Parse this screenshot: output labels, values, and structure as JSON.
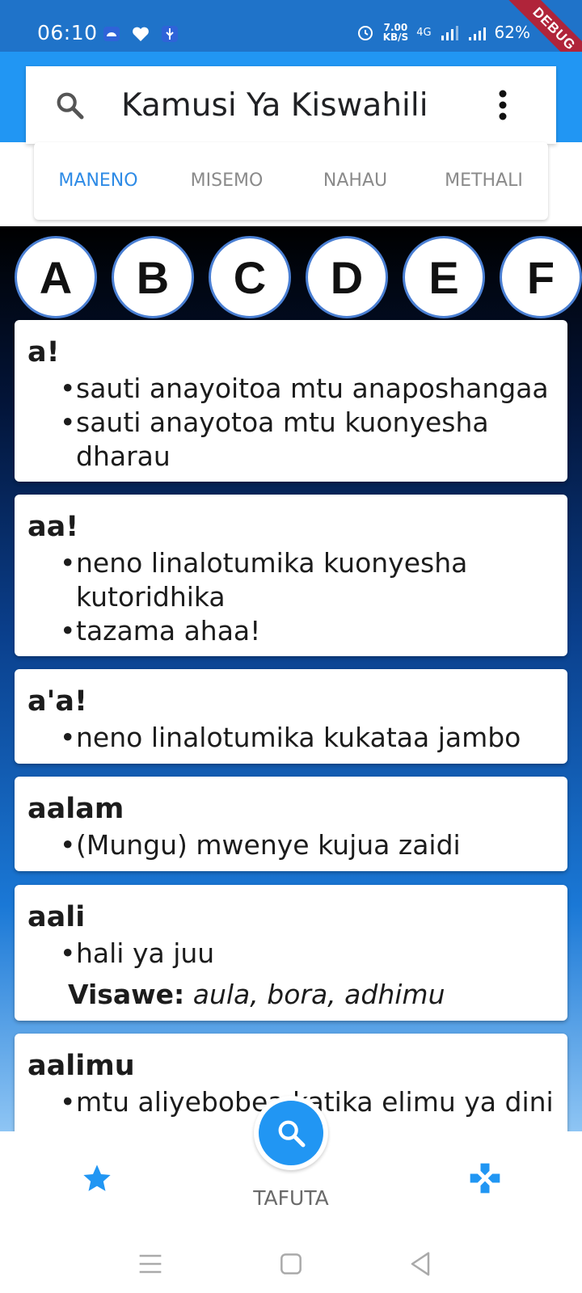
{
  "status": {
    "time": "06:10",
    "net_speed_value": "7.00",
    "net_speed_unit": "KB/S",
    "network": "4G",
    "battery": "62%",
    "debug_label": "DEBUG"
  },
  "header": {
    "title": "Kamusi Ya Kiswahili",
    "tabs": [
      {
        "label": "MANENO",
        "active": true
      },
      {
        "label": "MISEMO",
        "active": false
      },
      {
        "label": "NAHAU",
        "active": false
      },
      {
        "label": "METHALI",
        "active": false
      }
    ]
  },
  "letters": [
    "A",
    "B",
    "C",
    "D",
    "E",
    "F"
  ],
  "entries": [
    {
      "word": "a!",
      "definitions": [
        "sauti anayoitoa mtu anaposhangaa",
        "sauti anayotoa mtu kuonyesha dharau"
      ]
    },
    {
      "word": "aa!",
      "definitions": [
        "neno linalotumika kuonyesha kutoridhika",
        " tazama ahaa!"
      ]
    },
    {
      "word": "a'a!",
      "definitions": [
        "neno linalotumika kukataa jambo"
      ]
    },
    {
      "word": "aalam",
      "definitions": [
        "(Mungu) mwenye kujua zaidi"
      ]
    },
    {
      "word": "aali",
      "definitions": [
        "hali ya juu"
      ],
      "visawe_label": "Visawe:",
      "visawe": "aula, bora, adhimu"
    },
    {
      "word": "aalimu",
      "definitions": [
        "mtu aliyebobea katika elimu ya dini"
      ]
    }
  ],
  "bottom": {
    "center_label": "TAFUTA"
  },
  "colors": {
    "primary": "#2196f3",
    "status_bar": "#1f73c9",
    "active_tab": "#2e8be6",
    "debug": "#b0243a"
  }
}
